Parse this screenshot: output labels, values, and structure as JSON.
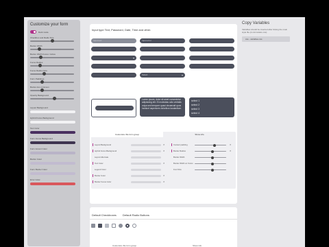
{
  "sidebar": {
    "title": "Customize your form",
    "dark_mode_label": "Dark mode",
    "sliders": [
      {
        "label": "Checkbox and Radio Size",
        "value": 0.5
      },
      {
        "label": "Border Width",
        "value": 0.18
      },
      {
        "label": "Border Width Focus / Active",
        "value": 0.22
      },
      {
        "label": "Focus Radius",
        "value": 0.2
      },
      {
        "label": "Focus Radius Size",
        "value": 0.3
      },
      {
        "label": "Form Paddings",
        "value": 0.25
      },
      {
        "label": "Border-box minimum",
        "value": 0.25
      },
      {
        "label": "Opacity Background",
        "value": 0.55
      }
    ],
    "colors": [
      {
        "label": "Layout Background",
        "color": "#f2f2f4"
      },
      {
        "label": "Hybrid Focus Background",
        "color": "#f2f2f4"
      },
      {
        "label": "Text Color",
        "color": "#4a3060"
      },
      {
        "label": "Form Focus Background",
        "color": "#3f3550"
      },
      {
        "label": "Form Accent Color",
        "color": "#b9b3c7"
      },
      {
        "label": "Border Color",
        "color": "#c2bbd0"
      },
      {
        "label": "Form Border Color",
        "color": "#c2bbd0"
      },
      {
        "label": "Error Color",
        "color": "#d9575c"
      }
    ]
  },
  "main": {
    "heading": "Input type Text, Password, Date, Time and other.",
    "inputs": [
      {
        "value": "Input text",
        "style": "light"
      },
      {
        "value": "Input error",
        "style": "dark"
      },
      {
        "value": "",
        "style": "dark"
      },
      {
        "value": "",
        "style": "dark"
      },
      {
        "value": "",
        "style": "dark"
      },
      {
        "value": "",
        "style": "dark"
      },
      {
        "value": "",
        "style": "dark"
      },
      {
        "value": "",
        "style": "dark"
      },
      {
        "value": "",
        "style": "dark"
      },
      {
        "value": "",
        "style": "dark"
      },
      {
        "value": "",
        "style": "dark"
      },
      {
        "value": "",
        "style": "dark"
      },
      {
        "value": "",
        "style": "dark"
      },
      {
        "value": "Select",
        "style": "dark"
      }
    ],
    "textarea": "Lorem ipsum, dolor sit amet consectetur adipisicing elit. Et molestias odio veritatis culpa sed tempore quasi obcaecati quos incidunt asperiores doloribus laudantium.",
    "listbox": [
      "select 1",
      "select 2",
      "select 3",
      "select 4"
    ],
    "panel": {
      "tabs": [
        "Customize this form group",
        "Show info"
      ],
      "rows_left": [
        {
          "label": "Layout Background",
          "mark": "#b0308a",
          "x": true
        },
        {
          "label": "Hybrid Focus Background",
          "mark": "#b0308a",
          "x": true
        },
        {
          "label": "Layout Alternate",
          "mark": "",
          "x": false
        },
        {
          "label": "Text Color",
          "mark": "#b0308a",
          "x": true
        },
        {
          "label": "Legend Color",
          "mark": "",
          "x": false
        },
        {
          "label": "Border Color",
          "mark": "#b0308a",
          "x": true
        },
        {
          "label": "Border Focus Color",
          "mark": "#b0308a",
          "x": true
        }
      ],
      "rows_right": [
        {
          "label": "Content padding",
          "mark": "#b0308a",
          "x": true,
          "value": 0.62
        },
        {
          "label": "Border Radius",
          "mark": "#b0308a",
          "x": true,
          "value": 0.55
        },
        {
          "label": "Border Width",
          "mark": "",
          "x": false,
          "value": 0.55
        },
        {
          "label": "Border Width on Focus",
          "mark": "",
          "x": false,
          "value": 0.55
        },
        {
          "label": "Font Size",
          "mark": "",
          "x": false,
          "value": 0.55
        }
      ]
    }
  },
  "card2": {
    "tabs": [
      "Default Checkboxes",
      "Default Radio Buttons"
    ],
    "footer_left": "Customize this form group",
    "footer_right": "Show info"
  },
  "right": {
    "title": "Copy Variables",
    "description": "Variables should be inserted after linking the main style file (cx-formulaire.css)",
    "code": "css - variables.css"
  }
}
